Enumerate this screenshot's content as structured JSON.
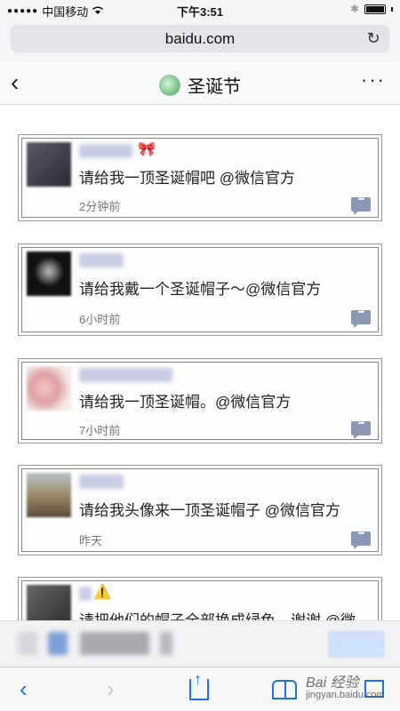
{
  "status_bar": {
    "carrier": "中国移动",
    "time": "下午3:51",
    "signal_dots": "●●●●●"
  },
  "browser": {
    "url": "baidu.com",
    "reload_icon": "reload-icon"
  },
  "header": {
    "back_icon": "chevron-left-icon",
    "title": "圣诞节",
    "more_label": "···"
  },
  "comments": [
    {
      "badge": "🎀",
      "text": "请给我一顶圣诞帽吧 @微信官方",
      "time": "2分钟前",
      "avatar_color": "#3b3a46"
    },
    {
      "badge": "",
      "text": "请给我戴一个圣诞帽子～@微信官方",
      "time": "6小时前",
      "avatar_color": "#161616"
    },
    {
      "badge": "",
      "text": "请给我一顶圣诞帽。@微信官方",
      "time": "7小时前",
      "avatar_color": "#d8a8a8"
    },
    {
      "badge": "",
      "text": "请给我头像来一顶圣诞帽子 @微信官方",
      "time": "昨天",
      "avatar_color": "#8a7a62"
    },
    {
      "badge": "⚠️",
      "text": "请把他们的帽子全部换成绿色，谢谢 @微",
      "time": "",
      "avatar_color": "#4a4a4a"
    }
  ],
  "watermark": {
    "brand": "Bai 经验",
    "url": "jingyan.baidu.com"
  },
  "toolbar": {
    "back": "‹",
    "forward": "›"
  },
  "colors": {
    "reply_icon": "#8898b5",
    "toolbar_accent": "#1a73e8"
  }
}
